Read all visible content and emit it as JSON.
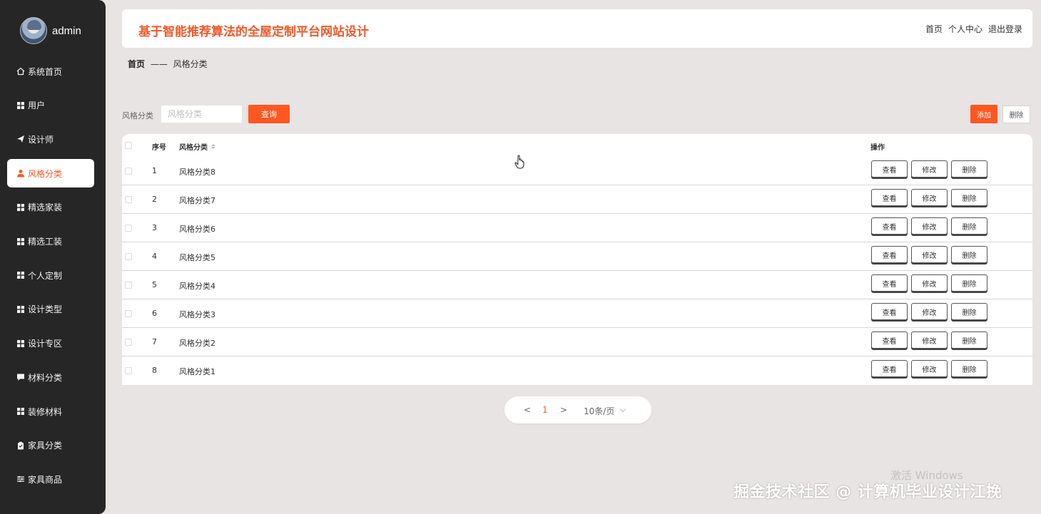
{
  "user": {
    "name": "admin"
  },
  "sidebar": {
    "items": [
      {
        "label": "系统首页",
        "icon": "home-icon"
      },
      {
        "label": "用户",
        "icon": "grid-icon"
      },
      {
        "label": "设计师",
        "icon": "send-icon"
      },
      {
        "label": "风格分类",
        "icon": "user-icon",
        "active": true
      },
      {
        "label": "精选家装",
        "icon": "grid-icon"
      },
      {
        "label": "精选工装",
        "icon": "grid-icon"
      },
      {
        "label": "个人定制",
        "icon": "grid-icon"
      },
      {
        "label": "设计类型",
        "icon": "grid-icon"
      },
      {
        "label": "设计专区",
        "icon": "grid-icon"
      },
      {
        "label": "材料分类",
        "icon": "chat-icon"
      },
      {
        "label": "装修材料",
        "icon": "grid-icon"
      },
      {
        "label": "家具分类",
        "icon": "clipboard-icon"
      },
      {
        "label": "家具商品",
        "icon": "sliders-icon"
      }
    ]
  },
  "header": {
    "title": "基于智能推荐算法的全屋定制平台网站设计",
    "links": {
      "home": "首页",
      "profile": "个人中心",
      "logout": "退出登录"
    }
  },
  "breadcrumb": {
    "home": "首页",
    "separator": "——",
    "current": "风格分类"
  },
  "search": {
    "label": "风格分类",
    "placeholder": "风格分类",
    "query_label": "查询"
  },
  "toolbar": {
    "add_label": "添加",
    "delete_label": "删除"
  },
  "table": {
    "columns": {
      "index": "序号",
      "category": "风格分类",
      "actions": "操作"
    },
    "rows": [
      {
        "index": "1",
        "category": "风格分类8"
      },
      {
        "index": "2",
        "category": "风格分类7"
      },
      {
        "index": "3",
        "category": "风格分类6"
      },
      {
        "index": "4",
        "category": "风格分类5"
      },
      {
        "index": "5",
        "category": "风格分类4"
      },
      {
        "index": "6",
        "category": "风格分类3"
      },
      {
        "index": "7",
        "category": "风格分类2"
      },
      {
        "index": "8",
        "category": "风格分类1"
      }
    ],
    "actions": {
      "view": "查看",
      "edit": "修改",
      "delete": "删除"
    }
  },
  "pagination": {
    "prev": "<",
    "current_page": "1",
    "next": ">",
    "page_size": "10条/页"
  },
  "overlay": {
    "activate_windows": "激活 Windows",
    "watermark": "掘金技术社区 @ 计算机毕业设计江挽"
  },
  "colors": {
    "accent": "#ff5722",
    "title": "#ef5a2b",
    "sidebar_bg": "#262626",
    "page_bg": "#e8e4e3"
  }
}
